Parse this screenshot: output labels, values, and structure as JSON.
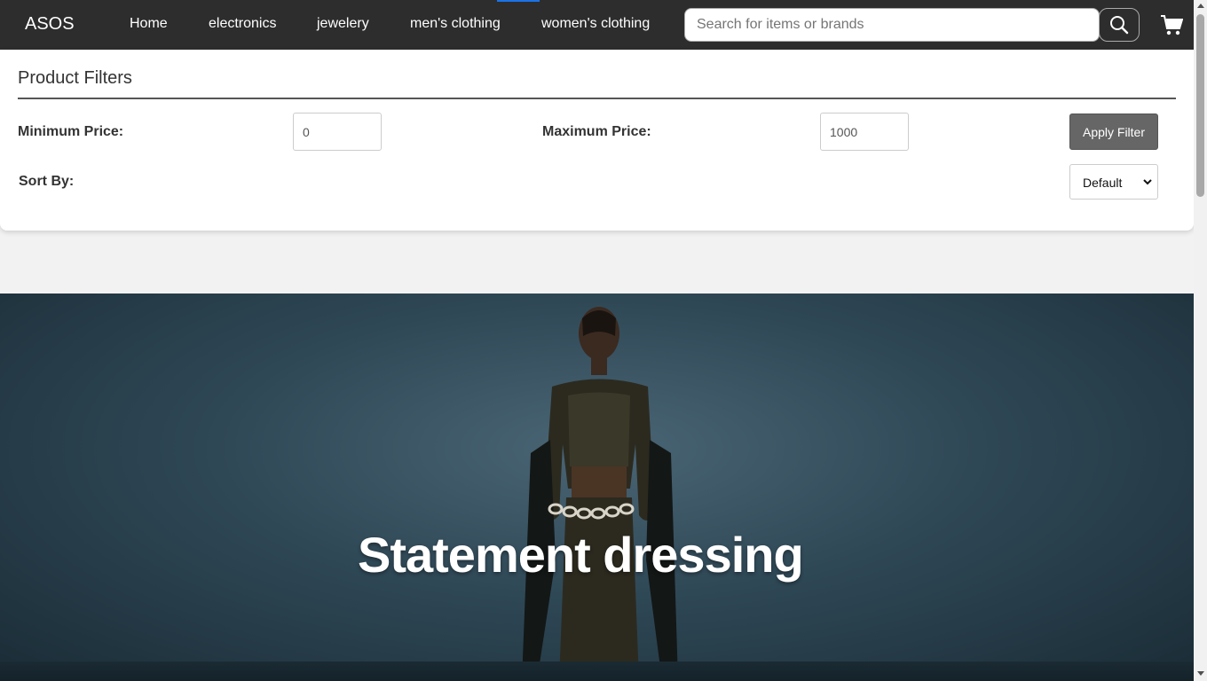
{
  "nav": {
    "brand": "ASOS",
    "links": [
      "Home",
      "electronics",
      "jewelery",
      "men's clothing",
      "women's clothing"
    ],
    "search_placeholder": "Search for items or brands",
    "search_icon": "search-icon",
    "cart_icon": "cart-icon"
  },
  "filters": {
    "title": "Product Filters",
    "min_label": "Minimum Price:",
    "min_value": "0",
    "max_label": "Maximum Price:",
    "max_value": "1000",
    "apply_label": "Apply Filter",
    "sort_label": "Sort By:",
    "sort_value": "Default"
  },
  "hero": {
    "headline": "Statement dressing"
  },
  "colors": {
    "navbar": "#2d2d2d",
    "apply_button": "#666666",
    "hero_background": "#2f4856"
  }
}
